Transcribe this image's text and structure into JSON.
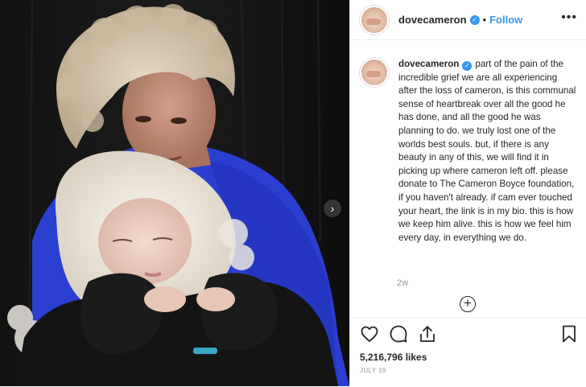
{
  "post": {
    "username": "dovecameron",
    "follow_label": "Follow",
    "separator": "•",
    "more_label": "•••",
    "caption": "part of the pain of the incredible grief we are all experiencing after the loss of cameron, is this communal sense of heartbreak over all the good he has done, and all the good he was planning to do. we truly lost one of the worlds best souls. but, if there is any beauty in any of this, we will find it in picking up where cameron left off. please donate to The Cameron Boyce foundation, if you haven't already. if cam ever touched your heart, the link is in my bio. this is how we keep him alive. this is how we feel him every day, in everything we do.",
    "time_ago": "2w",
    "likes": "5,216,796 likes",
    "date": "JULY 19",
    "next_arrow": "›",
    "load_more": "+",
    "verified_mark": "✓"
  },
  "icons": {
    "like": "heart-icon",
    "comment": "comment-icon",
    "share": "share-icon",
    "save": "bookmark-icon"
  },
  "colors": {
    "accent": "#3897f0",
    "text": "#262626",
    "muted": "#999999",
    "border": "#efefef"
  }
}
